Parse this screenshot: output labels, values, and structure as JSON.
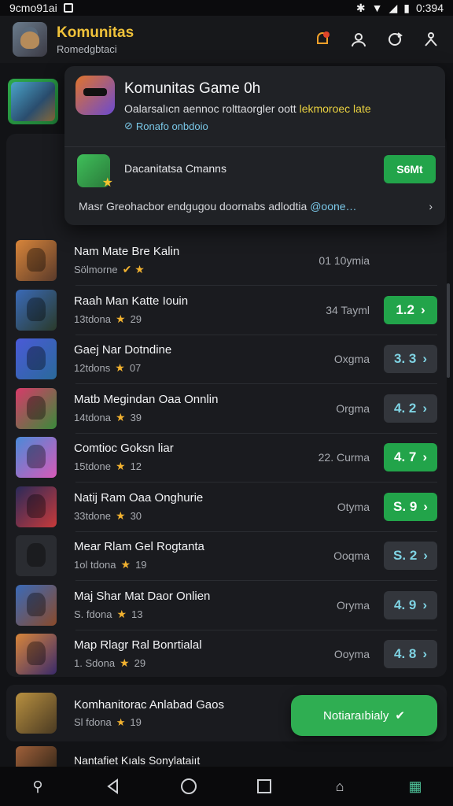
{
  "status_bar": {
    "time_left": "9cmo91ai",
    "time_right": "0:394"
  },
  "app": {
    "title": "Komunitas",
    "subtitle": "Romedgbtaci",
    "actions": [
      "bell-icon",
      "user-icon",
      "refresh-icon",
      "profile-icon"
    ]
  },
  "popup": {
    "title": "Komunitas Game 0h",
    "desc_main": "Oalarsalıcn aennoc  rolttaorgler oott ",
    "desc_highlight": "lekmoroec late",
    "link": "Ronafo onbdoio",
    "mid_label": "Dacanitatsa Cmanns",
    "mid_button": "S6Mt",
    "bottom_text": "Masr Greohacbor endgugou doornabs adlodtia",
    "bottom_mention": "@oone…"
  },
  "rows": [
    {
      "title": "Nam Mate Bre Kalin",
      "meta": "Sölmorne",
      "badge": "✔ ★",
      "count": "01 10ymia",
      "button": "",
      "button_style": "none",
      "thumb": [
        "#d8853a",
        "#5a3a2a"
      ]
    },
    {
      "title": "Raah Man Katte Iouin",
      "meta": "13tdona",
      "rating": "29",
      "count": "34 Tayml",
      "button": "1.2",
      "button_style": "green",
      "thumb": [
        "#3a6ab8",
        "#2a3a2a"
      ]
    },
    {
      "title": "Gaej Nar Dotndine",
      "meta": "12tdons",
      "rating": "07",
      "count": "Oxgma",
      "button": "3. 3",
      "button_style": "dark",
      "thumb": [
        "#4a5ad8",
        "#2a6a9a"
      ]
    },
    {
      "title": "Matb Megindan Oaa Onnlin",
      "meta": "14tdona",
      "rating": "39",
      "count": "Orgma",
      "button": "4. 2",
      "button_style": "dark",
      "thumb": [
        "#d83a6a",
        "#3a8a3a"
      ]
    },
    {
      "title": "Comtioc Goksn liar",
      "meta": "15tdone",
      "rating": "12",
      "count": "22. Curma",
      "button": "4. 7",
      "button_style": "green",
      "thumb": [
        "#4a8ad8",
        "#d85ab8"
      ]
    },
    {
      "title": "Natij Ram Oaa Onghurie",
      "meta": "33tdone",
      "rating": "30",
      "count": "Otyma",
      "button": "S. 9",
      "button_style": "green",
      "thumb": [
        "#2a2a5a",
        "#c83a3a"
      ]
    },
    {
      "title": "Mear Rlam Gel Rogtanta",
      "meta": "1ol tdona",
      "rating": "19",
      "count": "Ooqma",
      "button": "S. 2",
      "button_style": "dark",
      "thumb": [
        "#2a2c31",
        "#2a2c31"
      ]
    },
    {
      "title": "Maj Shar Mat Daor Onlien",
      "meta": "S. fdona",
      "rating": "13",
      "count": "Oryma",
      "button": "4. 9",
      "button_style": "dark",
      "thumb": [
        "#3a6ab8",
        "#8a4a2a"
      ]
    },
    {
      "title": "Map Rlagr Ral Bonrtialal",
      "meta": "1. Sdona",
      "rating": "29",
      "count": "Ooyma",
      "button": "4. 8",
      "button_style": "dark",
      "thumb": [
        "#d8853a",
        "#3a2a6a"
      ]
    }
  ],
  "bottom_card": {
    "title": "Komhanitorac Anlabad Gaos",
    "meta": "Sl fdona",
    "rating": "19"
  },
  "cta": {
    "label": "Notiaraıbialy"
  },
  "partial_row": {
    "title": "Nantafiet Kıals Sonylataiıt"
  },
  "nav": [
    "bug-icon",
    "back-icon",
    "home-icon",
    "recents-icon",
    "store-icon",
    "grid-icon"
  ]
}
